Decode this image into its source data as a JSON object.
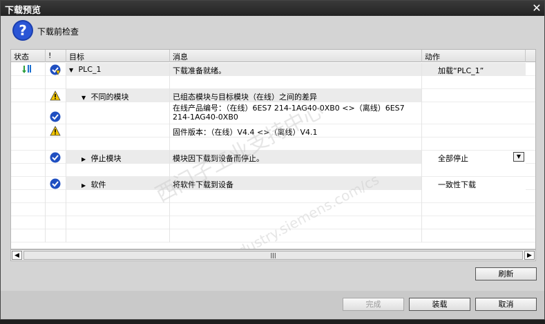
{
  "window": {
    "title": "下载预览",
    "close_label": "✕"
  },
  "header": {
    "title": "下载前检查"
  },
  "columns": [
    "状态",
    "!",
    "目标",
    "消息",
    "动作"
  ],
  "rows": [
    {
      "target": "PLC_1",
      "message": "下载准备就绪。",
      "action": "加载“PLC_1”"
    },
    {
      "target": "",
      "message": "",
      "action": ""
    },
    {
      "target": "不同的模块",
      "message": "已组态模块与目标模块（在线）之间的差异",
      "action": ""
    },
    {
      "target": "",
      "message_line1": "在线产品编号：（在线）6ES7 214-1AG40-0XB0 <>（离线）6ES7",
      "message_line2": "214-1AG40-0XB0",
      "action": ""
    },
    {
      "target": "",
      "message": "固件版本：（在线）V4.4 <>（离线）V4.1",
      "action": ""
    },
    {
      "target": "",
      "message": "",
      "action": ""
    },
    {
      "target": "停止模块",
      "message": "模块因下载到设备而停止。",
      "action": "全部停止"
    },
    {
      "target": "",
      "message": "",
      "action": ""
    },
    {
      "target": "软件",
      "message": "将软件下载到设备",
      "action": "一致性下载"
    }
  ],
  "watermark": {
    "line1": "西门子工业支持中心",
    "line2": "support.industry.siemens.com/cs"
  },
  "buttons": {
    "refresh": "刷新",
    "finish": "完成",
    "load": "装载",
    "cancel": "取消"
  },
  "colors": {
    "ok": "#1f4fc1",
    "warn": "#f2c500",
    "title_bg": "#2b2b2b"
  }
}
